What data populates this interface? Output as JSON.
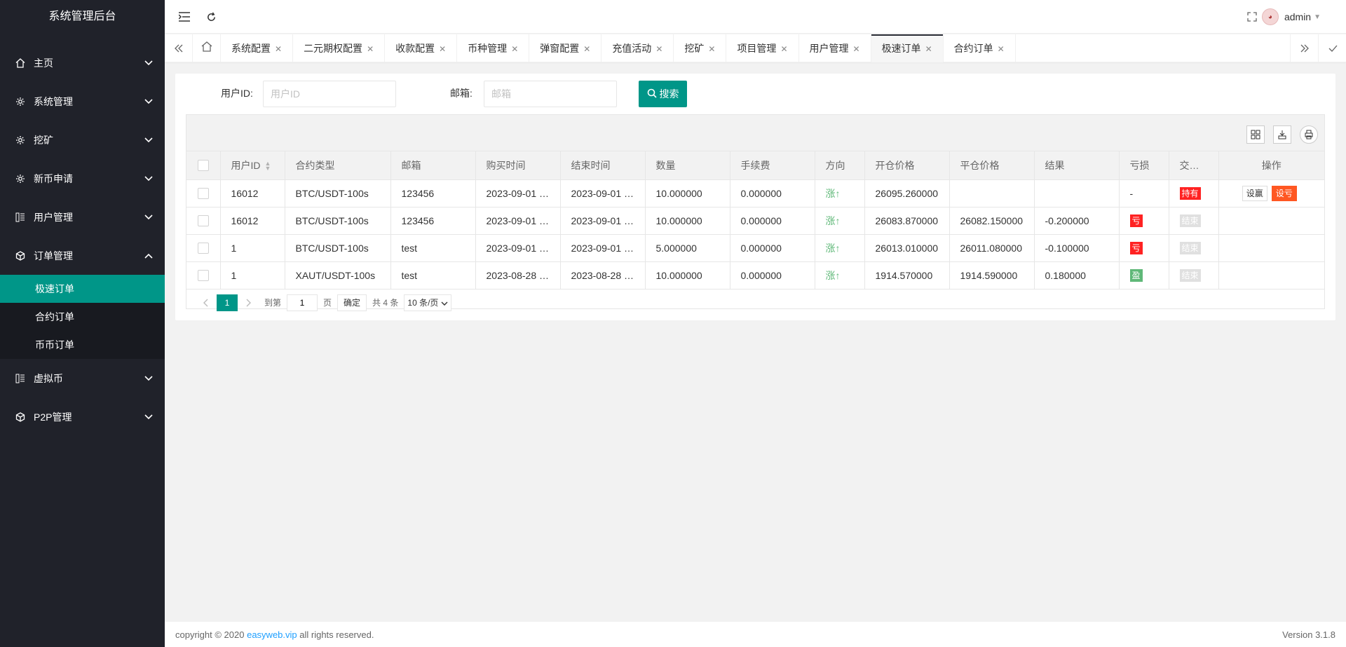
{
  "app": {
    "title": "系统管理后台"
  },
  "sidebar": {
    "items": [
      {
        "label": "主页",
        "icon": "home-icon"
      },
      {
        "label": "系统管理",
        "icon": "gear-icon"
      },
      {
        "label": "挖矿",
        "icon": "gear-icon"
      },
      {
        "label": "新币申请",
        "icon": "gear-icon"
      },
      {
        "label": "用户管理",
        "icon": "list-icon"
      },
      {
        "label": "订单管理",
        "icon": "cube-icon",
        "expanded": true,
        "children": [
          {
            "label": "极速订单",
            "active": true
          },
          {
            "label": "合约订单"
          },
          {
            "label": "币币订单"
          }
        ]
      },
      {
        "label": "虚拟币",
        "icon": "list-icon"
      },
      {
        "label": "P2P管理",
        "icon": "cube-icon"
      }
    ]
  },
  "header": {
    "user": "admin"
  },
  "tabs": [
    {
      "label": "系统配置"
    },
    {
      "label": "二元期权配置"
    },
    {
      "label": "收款配置"
    },
    {
      "label": "币种管理"
    },
    {
      "label": "弹窗配置"
    },
    {
      "label": "充值活动"
    },
    {
      "label": "挖矿"
    },
    {
      "label": "项目管理"
    },
    {
      "label": "用户管理"
    },
    {
      "label": "极速订单",
      "active": true
    },
    {
      "label": "合约订单"
    }
  ],
  "search": {
    "userid_label": "用户ID:",
    "userid_placeholder": "用户ID",
    "email_label": "邮箱:",
    "email_placeholder": "邮箱",
    "button": "搜索"
  },
  "table": {
    "columns": [
      "用户ID",
      "合约类型",
      "邮箱",
      "购买时间",
      "结束时间",
      "数量",
      "手续费",
      "方向",
      "开仓价格",
      "平仓价格",
      "结果",
      "亏损",
      "交…",
      "操作"
    ],
    "rows": [
      {
        "uid": "16012",
        "type": "BTC/USDT-100s",
        "email": "123456",
        "buy": "2023-09-01 …",
        "end": "2023-09-01 …",
        "qty": "10.000000",
        "fee": "0.000000",
        "dir": "涨↑",
        "open": "26095.260000",
        "close": "",
        "result": "",
        "loss": "-",
        "status": "持有",
        "status_color": "red",
        "ops": [
          "设赢",
          "设亏"
        ]
      },
      {
        "uid": "16012",
        "type": "BTC/USDT-100s",
        "email": "123456",
        "buy": "2023-09-01 …",
        "end": "2023-09-01 …",
        "qty": "10.000000",
        "fee": "0.000000",
        "dir": "涨↑",
        "open": "26083.870000",
        "close": "26082.150000",
        "result": "-0.200000",
        "loss": "亏",
        "loss_color": "red",
        "status": "结束",
        "status_color": "gray",
        "ops": []
      },
      {
        "uid": "1",
        "type": "BTC/USDT-100s",
        "email": "test",
        "buy": "2023-09-01 …",
        "end": "2023-09-01 …",
        "qty": "5.000000",
        "fee": "0.000000",
        "dir": "涨↑",
        "open": "26013.010000",
        "close": "26011.080000",
        "result": "-0.100000",
        "loss": "亏",
        "loss_color": "red",
        "status": "结束",
        "status_color": "gray",
        "ops": []
      },
      {
        "uid": "1",
        "type": "XAUT/USDT-100s",
        "email": "test",
        "buy": "2023-08-28 …",
        "end": "2023-08-28 …",
        "qty": "10.000000",
        "fee": "0.000000",
        "dir": "涨↑",
        "open": "1914.570000",
        "close": "1914.590000",
        "result": "0.180000",
        "loss": "盈",
        "loss_color": "green",
        "status": "结束",
        "status_color": "gray",
        "ops": []
      }
    ]
  },
  "pager": {
    "current": "1",
    "goto_label": "到第",
    "goto_value": "1",
    "page_label": "页",
    "ok": "确定",
    "total": "共 4 条",
    "size": "10 条/页"
  },
  "footer": {
    "copyright_prefix": "copyright © 2020 ",
    "link": "easyweb.vip",
    "copyright_suffix": " all rights reserved.",
    "version": "Version 3.1.8"
  },
  "colors": {
    "sidebar_bg": "#20222a",
    "accent": "#009688",
    "danger": "#ff2222",
    "orange": "#ff5722"
  }
}
